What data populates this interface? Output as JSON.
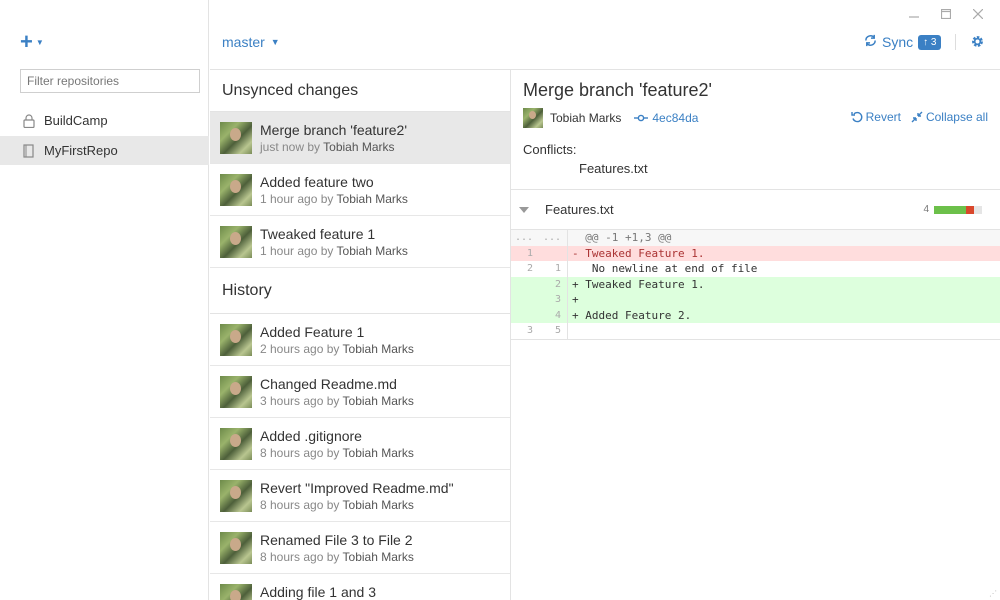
{
  "window": {
    "minimize_icon": "minimize-icon",
    "maximize_icon": "maximize-icon",
    "close_icon": "close-icon"
  },
  "sidebar": {
    "add_label": "+",
    "filter_placeholder": "Filter repositories",
    "repos": [
      {
        "name": "BuildCamp",
        "icon": "lock-icon",
        "selected": false
      },
      {
        "name": "MyFirstRepo",
        "icon": "book-icon",
        "selected": true
      }
    ]
  },
  "header": {
    "branch": "master",
    "sync_label": "Sync",
    "sync_badge": "↑ 3"
  },
  "commits": {
    "unsynced_title": "Unsynced changes",
    "history_title": "History",
    "unsynced": [
      {
        "title": "Merge branch 'feature2'",
        "time": "just now by",
        "author": "Tobiah Marks",
        "selected": true
      },
      {
        "title": "Added feature two",
        "time": "1 hour ago by",
        "author": "Tobiah Marks",
        "selected": false
      },
      {
        "title": "Tweaked feature 1",
        "time": "1 hour ago by",
        "author": "Tobiah Marks",
        "selected": false
      }
    ],
    "history": [
      {
        "title": "Added Feature 1",
        "time": "2 hours ago by",
        "author": "Tobiah Marks"
      },
      {
        "title": "Changed Readme.md",
        "time": "3 hours ago by",
        "author": "Tobiah Marks"
      },
      {
        "title": "Added .gitignore",
        "time": "8 hours ago by",
        "author": "Tobiah Marks"
      },
      {
        "title": "Revert \"Improved Readme.md\"",
        "time": "8 hours ago by",
        "author": "Tobiah Marks"
      },
      {
        "title": "Renamed File 3 to File 2",
        "time": "8 hours ago by",
        "author": "Tobiah Marks"
      },
      {
        "title": "Adding file 1 and 3",
        "time": "",
        "author": ""
      }
    ]
  },
  "detail": {
    "title": "Merge branch 'feature2'",
    "author": "Tobiah Marks",
    "sha": "4ec84da",
    "revert_label": "Revert",
    "collapse_label": "Collapse all",
    "conflicts_label": "Conflicts:",
    "conflict_file": "Features.txt",
    "file": {
      "name": "Features.txt",
      "change_count": "4",
      "stat_colors": [
        "#6cc04a",
        "#6cc04a",
        "#6cc04a",
        "#6cc04a",
        "#d9472b",
        "#e5e5e5"
      ]
    },
    "diff": [
      {
        "type": "hunk",
        "old": "...",
        "new": "...",
        "text": "  @@ -1 +1,3 @@"
      },
      {
        "type": "del",
        "old": "1",
        "new": "",
        "text": "- Tweaked Feature 1."
      },
      {
        "type": "ctx",
        "old": "2",
        "new": "1",
        "text": "   No newline at end of file"
      },
      {
        "type": "add",
        "old": "",
        "new": "2",
        "text": "+ Tweaked Feature 1."
      },
      {
        "type": "add",
        "old": "",
        "new": "3",
        "text": "+"
      },
      {
        "type": "add",
        "old": "",
        "new": "4",
        "text": "+ Added Feature 2."
      },
      {
        "type": "ctx",
        "old": "3",
        "new": "5",
        "text": ""
      }
    ]
  },
  "colors": {
    "accent": "#3b80c4",
    "selected_bg": "#e8e8e8",
    "diff_add": "#ddffdd",
    "diff_del": "#ffdddd"
  }
}
